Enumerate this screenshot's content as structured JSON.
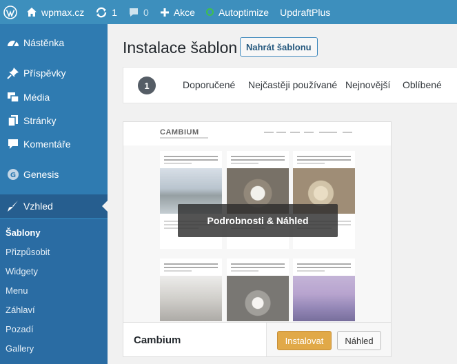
{
  "adminbar": {
    "site_name": "wpmax.cz",
    "updates_count": "1",
    "comments_count": "0",
    "new_label": "Akce",
    "autoptimize_label": "Autoptimize",
    "updraft_label": "UpdraftPlus"
  },
  "sidebar": {
    "dashboard": "Nástěnka",
    "posts": "Příspěvky",
    "media": "Média",
    "pages": "Stránky",
    "comments": "Komentáře",
    "genesis": "Genesis",
    "appearance": "Vzhled",
    "submenu": [
      "Šablony",
      "Přizpůsobit",
      "Widgety",
      "Menu",
      "Záhlaví",
      "Pozadí",
      "Gallery"
    ]
  },
  "header": {
    "title": "Instalace šablon",
    "upload_button": "Nahrát šablonu"
  },
  "filters": {
    "count": "1",
    "tabs": [
      "Doporučené",
      "Nejčastěji používané",
      "Nejnovější",
      "Oblíbené"
    ]
  },
  "theme": {
    "name": "Cambium",
    "screenshot_logo": "CAMBIUM",
    "overlay_label": "Podrobnosti & Náhled",
    "install_label": "Instalovat",
    "preview_label": "Náhled"
  },
  "colors": {
    "adminbar": "#3d8fbd",
    "sidebar": "#2f7bb1",
    "sidebar_current": "#265e8f",
    "install_button": "#e1a948"
  }
}
